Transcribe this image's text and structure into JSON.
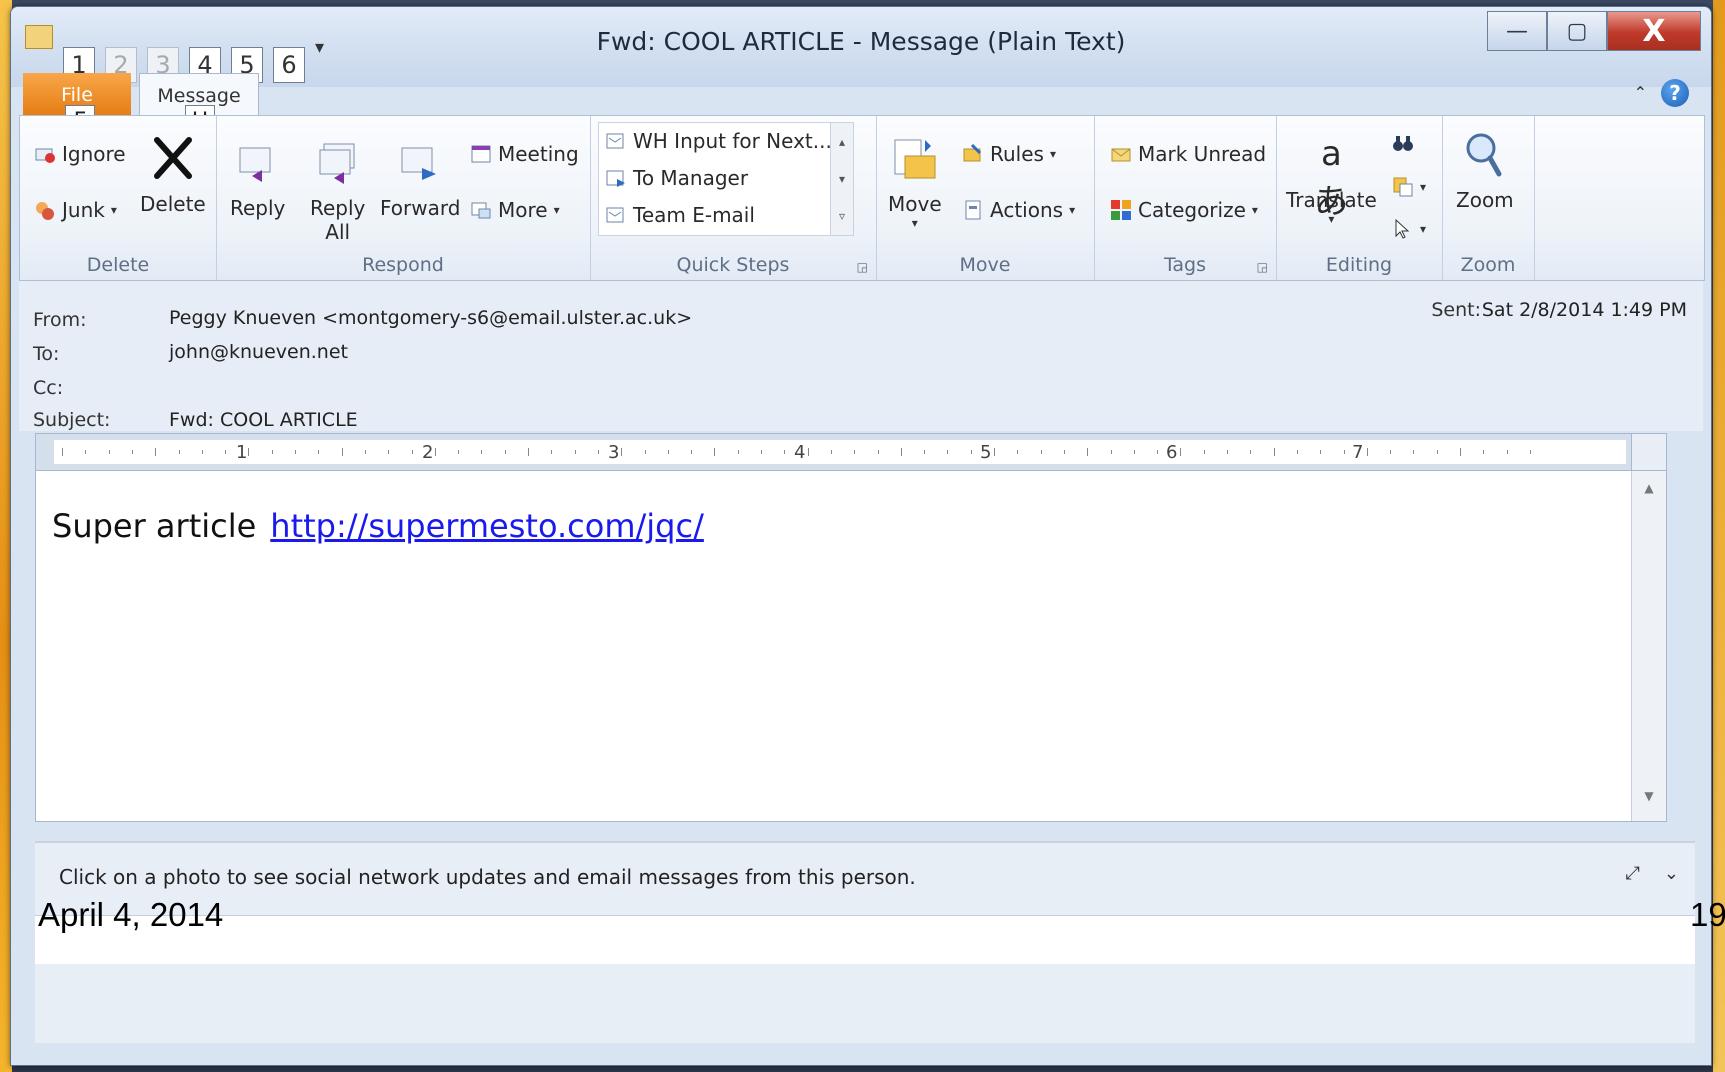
{
  "window": {
    "title": "Fwd: COOL ARTICLE  -  Message (Plain Text)",
    "keytips": [
      "1",
      "2",
      "3",
      "4",
      "5",
      "6"
    ],
    "qat_dropdown": "▾",
    "controls": {
      "minimize": "—",
      "maximize": "▢",
      "close": "X"
    }
  },
  "tabs": {
    "file": "File",
    "message": "Message",
    "file_keytip": "F",
    "message_keytip": "H",
    "help": "?",
    "collapse": "⌃"
  },
  "ribbon": {
    "delete_group": {
      "label": "Delete",
      "ignore": "Ignore",
      "junk": "Junk",
      "delete": "Delete"
    },
    "respond_group": {
      "label": "Respond",
      "reply": "Reply",
      "reply_all_line1": "Reply",
      "reply_all_line2": "All",
      "forward": "Forward",
      "meeting": "Meeting",
      "more": "More"
    },
    "quicksteps_group": {
      "label": "Quick Steps",
      "items": [
        "WH Input for Next...",
        "To Manager",
        "Team E-mail"
      ]
    },
    "move_group": {
      "label": "Move",
      "move": "Move",
      "rules": "Rules",
      "actions": "Actions"
    },
    "tags_group": {
      "label": "Tags",
      "mark_unread": "Mark Unread",
      "categorize": "Categorize"
    },
    "editing_group": {
      "label": "Editing",
      "translate": "Translate"
    },
    "zoom_group": {
      "label": "Zoom",
      "zoom": "Zoom"
    }
  },
  "header": {
    "from_label": "From:",
    "from_value": "Peggy Knueven <montgomery-s6@email.ulster.ac.uk>",
    "to_label": "To:",
    "to_value": "john@knueven.net",
    "cc_label": "Cc:",
    "subject_label": "Subject:",
    "subject_value": "Fwd: COOL ARTICLE",
    "sent_label": "Sent:",
    "sent_value": "Sat 2/8/2014 1:49 PM"
  },
  "ruler": {
    "numbers": [
      "1",
      "2",
      "3",
      "4",
      "5",
      "6",
      "7"
    ]
  },
  "body": {
    "text": "Super article",
    "link": "http://supermesto.com/jqc/"
  },
  "people_pane": {
    "text": "Click on a photo to see social network updates and email messages from this person."
  },
  "slide": {
    "date": "April 4, 2014",
    "number": "19"
  },
  "colors": {
    "file_tab": "#e57b12",
    "link": "#1a1aee",
    "close": "#c0392b"
  }
}
